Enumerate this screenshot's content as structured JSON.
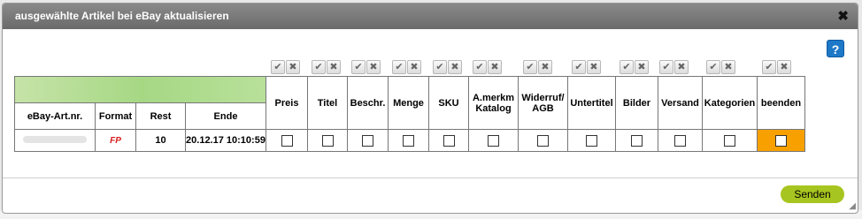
{
  "dialog": {
    "title": "ausgewählte Artikel bei eBay aktualisieren",
    "close": "✖",
    "help": "?"
  },
  "columns": {
    "ebay_art_nr": "eBay-Art.nr.",
    "format": "Format",
    "rest": "Rest",
    "ende": "Ende",
    "preis": "Preis",
    "titel": "Titel",
    "beschr": "Beschr.",
    "menge": "Menge",
    "sku": "SKU",
    "amerkm": "A.merkm",
    "katalog": "Katalog",
    "widerruf": "Widerruf/",
    "agb": "AGB",
    "untertitel": "Untertitel",
    "bilder": "Bilder",
    "versand": "Versand",
    "kategorien": "Kategorien",
    "beenden": "beenden"
  },
  "row": {
    "format": "FP",
    "rest": "10",
    "ende": "20.12.17 10:10:59"
  },
  "footer": {
    "send_label": "Senden"
  },
  "icons": {
    "check": "✔",
    "cross": "✖"
  }
}
